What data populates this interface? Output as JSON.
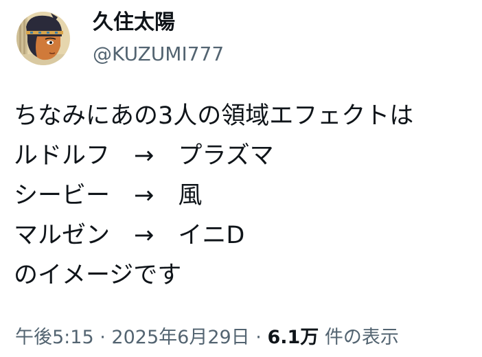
{
  "author": {
    "display_name": "久住太陽",
    "handle": "@KUZUMI777",
    "avatar_icon": "avatar-illustration"
  },
  "tweet": {
    "lines": [
      "ちなみにあの3人の領域エフェクトは",
      "ルドルフ　→　プラズマ",
      "シービー　→　風",
      "マルゼン　→　イニD",
      "のイメージです"
    ]
  },
  "meta": {
    "time": "午後5:15",
    "separator": "·",
    "date": "2025年6月29日",
    "views_count": "6.1万",
    "views_label": "件の表示"
  },
  "colors": {
    "text": "#0f1419",
    "secondary": "#536471",
    "background": "#ffffff"
  }
}
